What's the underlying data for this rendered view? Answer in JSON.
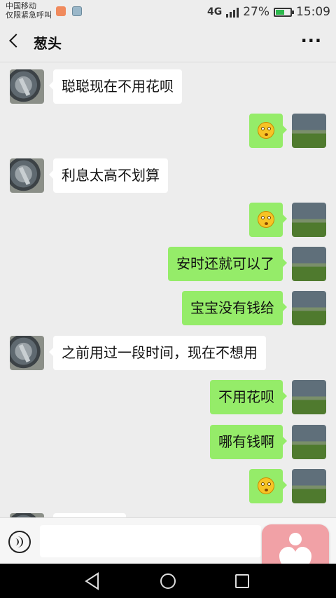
{
  "status_bar": {
    "carrier_line1": "中国移动",
    "carrier_line2": "仅限紧急呼叫",
    "network": "4G",
    "battery": "27%",
    "time": "15:09"
  },
  "header": {
    "title": "葱头",
    "back_icon": "chevron-left-icon",
    "more_icon": "more-icon",
    "more_text": "···"
  },
  "messages": [
    {
      "side": "left",
      "text": "聪聪现在不用花呗"
    },
    {
      "side": "right",
      "emoji": "flushed-face"
    },
    {
      "side": "left",
      "text": "利息太高不划算"
    },
    {
      "side": "right",
      "emoji": "flushed-face"
    },
    {
      "side": "right",
      "text": "安时还就可以了"
    },
    {
      "side": "right",
      "text": "宝宝没有钱给"
    },
    {
      "side": "left",
      "text": "之前用过一段时间，现在不想用"
    },
    {
      "side": "right",
      "text": "不用花呗"
    },
    {
      "side": "right",
      "text": "哪有钱啊"
    },
    {
      "side": "right",
      "emoji": "flushed-face"
    }
  ],
  "input_bar": {
    "voice_icon": "voice-icon",
    "input_value": ""
  },
  "colors": {
    "background": "#ededed",
    "sent_bubble": "#95ec69",
    "received_bubble": "#ffffff",
    "float_widget": "#f1a1a6"
  }
}
